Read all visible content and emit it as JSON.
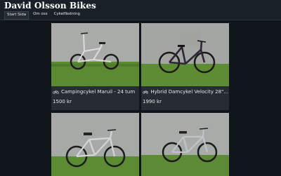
{
  "site": {
    "title": "David Olsson Bikes"
  },
  "nav": [
    {
      "label": "Start Sida",
      "active": true
    },
    {
      "label": "Om oss",
      "active": false
    },
    {
      "label": "Cykelfästning",
      "active": false
    }
  ],
  "listings": [
    {
      "title": "Campingcykel Maruil - 24 tum",
      "price": "1500 kr",
      "icon": "bicycle-icon",
      "frame_color": "#d8d8d8"
    },
    {
      "title": "Hybrid Damcykel Velocity 28\"...",
      "price": "1990 kr",
      "icon": "bicycle-icon",
      "frame_color": "#2a2330"
    },
    {
      "title": "",
      "price": "",
      "icon": "bicycle-icon",
      "frame_color": "#c9ccd0"
    },
    {
      "title": "",
      "price": "",
      "icon": "bicycle-icon",
      "frame_color": "#b9bcc0"
    }
  ],
  "colors": {
    "background": "#0f151b",
    "header": "#1a2027",
    "card": "#262c33",
    "wall": "#a7a9a6",
    "grass": "#5f8a35"
  }
}
